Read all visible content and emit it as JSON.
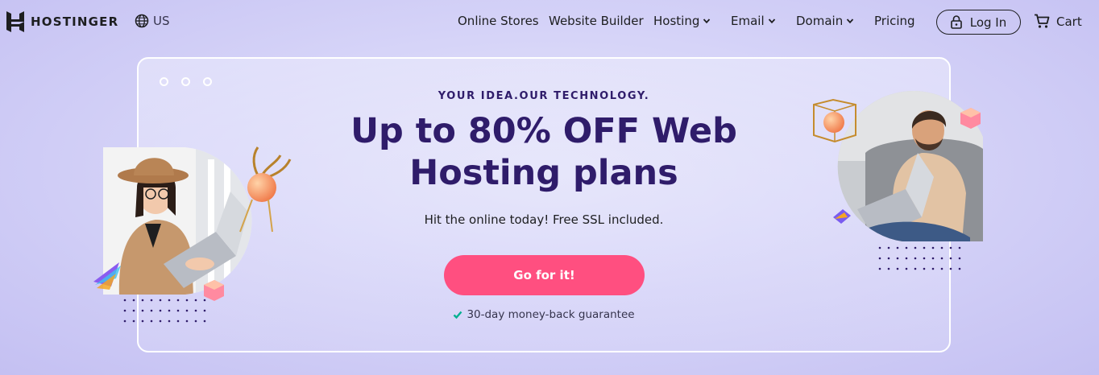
{
  "nav": {
    "brand": "HOSTINGER",
    "region": "US",
    "items": [
      {
        "label": "Online Stores",
        "dropdown": false
      },
      {
        "label": "Website Builder",
        "dropdown": false
      },
      {
        "label": "Hosting",
        "dropdown": true
      },
      {
        "label": "Email",
        "dropdown": true
      },
      {
        "label": "Domain",
        "dropdown": true
      },
      {
        "label": "Pricing",
        "dropdown": false
      }
    ],
    "login_label": "Log In",
    "cart_label": "Cart"
  },
  "hero": {
    "eyebrow": "YOUR IDEA.OUR TECHNOLOGY.",
    "headline_line1": "Up to 80% OFF Web",
    "headline_line2": "Hosting plans",
    "subtext": "Hit the online today! Free SSL included.",
    "cta_label": "Go for it!",
    "guarantee": "30-day money-back guarantee"
  },
  "colors": {
    "accent": "#ff4f80",
    "heading": "#2f1c6a",
    "check": "#00b090"
  },
  "icons": [
    "hostinger-logo-icon",
    "globe-icon",
    "chevron-down-icon",
    "lock-icon",
    "cart-icon",
    "check-icon"
  ]
}
